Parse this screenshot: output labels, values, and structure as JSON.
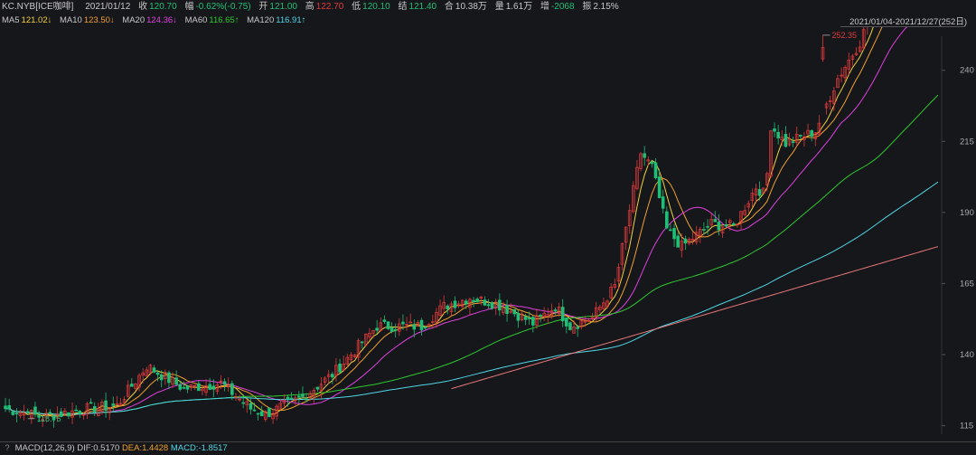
{
  "header": {
    "symbol": "KC.NYB[ICE咖啡]",
    "date": "2021/01/12",
    "close_label": "收",
    "close": "120.70",
    "change_label": "幅",
    "change": "-0.62%(-0.75)",
    "open_label": "开",
    "open": "121.00",
    "high_label": "高",
    "high": "122.70",
    "low_label": "低",
    "low": "120.10",
    "settle_label": "结",
    "settle": "121.40",
    "oi_label": "合",
    "oi": "10.38万",
    "vol_label": "量",
    "vol": "1.61万",
    "incr_label": "增",
    "incr": "-2068",
    "amp_label": "振",
    "amp": "2.15%"
  },
  "ma": [
    {
      "name": "MA5",
      "value": "121.02↓",
      "color": "#f2d23c"
    },
    {
      "name": "MA10",
      "value": "123.50↓",
      "color": "#f0a030"
    },
    {
      "name": "MA20",
      "value": "124.36↓",
      "color": "#e040e0"
    },
    {
      "name": "MA60",
      "value": "116.65↑",
      "color": "#2ec82e"
    },
    {
      "name": "MA120",
      "value": "116.91↑",
      "color": "#4fd6e6"
    }
  ],
  "range": "2021/01/04-2021/12/27(252日)",
  "macd": {
    "help": "?",
    "label": "MACD(12,26,9)",
    "dif_label": "DIF:",
    "dif": "0.5170",
    "dea_label": "DEA:",
    "dea": "1.4428",
    "macd_label": "MACD:",
    "macd": "-1.8517"
  },
  "chart_data": {
    "type": "candlestick",
    "title": "",
    "ylim": [
      112,
      252
    ],
    "y_ticks": [
      "115",
      "140",
      "165",
      "190",
      "215",
      "240"
    ],
    "y_tick_values": [
      115,
      140,
      165,
      190,
      215,
      240
    ],
    "max_label": "252.35",
    "max_value": 252.35,
    "min_label": "118.75",
    "min_value": 118.75,
    "up_color": "#e03a3a",
    "down_color": "#1fbf76",
    "candles": [],
    "ma_lines": [
      {
        "name": "MA5",
        "color": "#f2d23c"
      },
      {
        "name": "MA10",
        "color": "#f0a030"
      },
      {
        "name": "MA20",
        "color": "#e040e0"
      },
      {
        "name": "MA60",
        "color": "#2ec82e"
      },
      {
        "name": "MA120",
        "color": "#4fd6e6"
      },
      {
        "name": "MA250",
        "color": "#e87878"
      }
    ]
  }
}
